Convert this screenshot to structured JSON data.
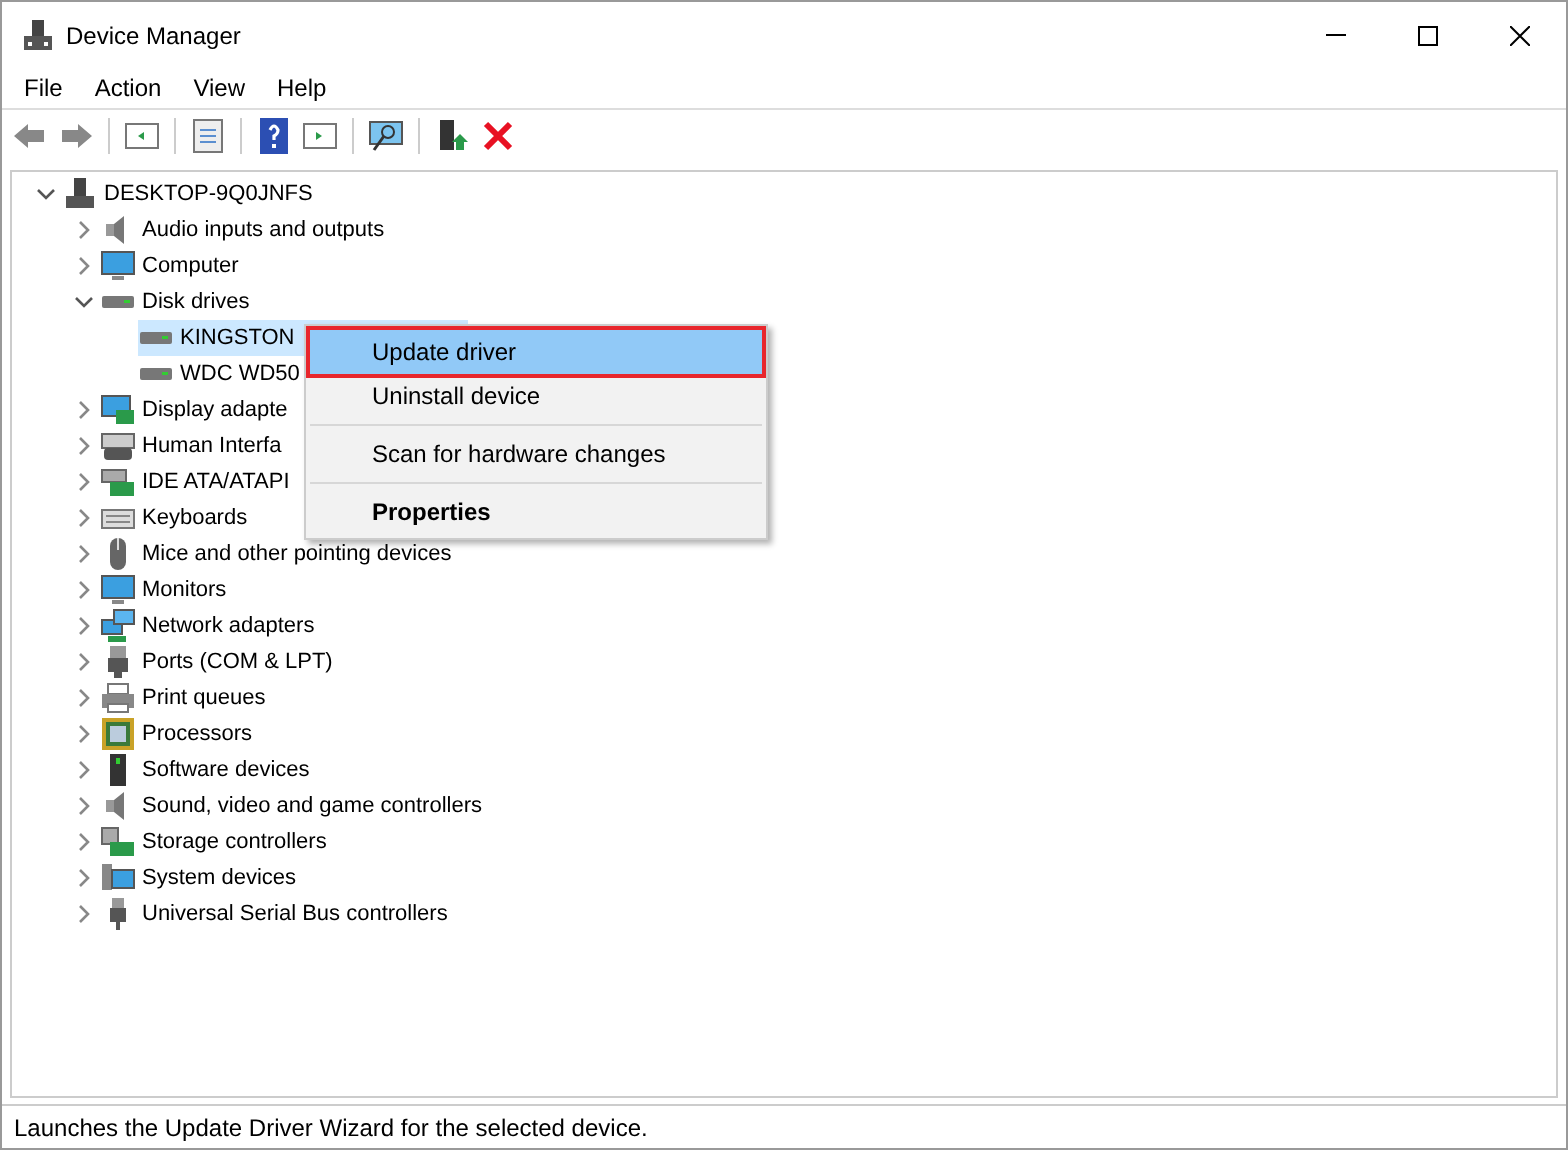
{
  "window": {
    "title": "Device Manager"
  },
  "menu_bar": [
    "File",
    "Action",
    "View",
    "Help"
  ],
  "tree": [
    {
      "label": "DESKTOP-9Q0JNFS",
      "expanded": true,
      "selected": false,
      "children": [
        {
          "label": "Audio inputs and outputs",
          "expanded": false,
          "selected": false
        },
        {
          "label": "Computer",
          "expanded": false,
          "selected": false
        },
        {
          "label": "Disk drives",
          "expanded": true,
          "selected": false,
          "children": [
            {
              "label": "KINGSTON",
              "selected": true
            },
            {
              "label": "WDC WD50",
              "selected": false
            }
          ]
        },
        {
          "label": "Display adapte",
          "expanded": false,
          "selected": false
        },
        {
          "label": "Human Interfa",
          "expanded": false,
          "selected": false
        },
        {
          "label": "IDE ATA/ATAPI",
          "expanded": false,
          "selected": false
        },
        {
          "label": "Keyboards",
          "expanded": false,
          "selected": false
        },
        {
          "label": "Mice and other pointing devices",
          "expanded": false,
          "selected": false
        },
        {
          "label": "Monitors",
          "expanded": false,
          "selected": false
        },
        {
          "label": "Network adapters",
          "expanded": false,
          "selected": false
        },
        {
          "label": "Ports (COM & LPT)",
          "expanded": false,
          "selected": false
        },
        {
          "label": "Print queues",
          "expanded": false,
          "selected": false
        },
        {
          "label": "Processors",
          "expanded": false,
          "selected": false
        },
        {
          "label": "Software devices",
          "expanded": false,
          "selected": false
        },
        {
          "label": "Sound, video and game controllers",
          "expanded": false,
          "selected": false
        },
        {
          "label": "Storage controllers",
          "expanded": false,
          "selected": false
        },
        {
          "label": "System devices",
          "expanded": false,
          "selected": false
        },
        {
          "label": "Universal Serial Bus controllers",
          "expanded": false,
          "selected": false
        }
      ]
    }
  ],
  "context_menu": {
    "groups": [
      [
        {
          "label": "Update driver",
          "selected": true,
          "default": false
        },
        {
          "label": "Uninstall device",
          "selected": false,
          "default": false
        }
      ],
      [
        {
          "label": "Scan for hardware changes",
          "selected": false,
          "default": false
        }
      ],
      [
        {
          "label": "Properties",
          "selected": false,
          "default": true
        }
      ]
    ]
  },
  "status_bar": "Launches the Update Driver Wizard for the selected device."
}
